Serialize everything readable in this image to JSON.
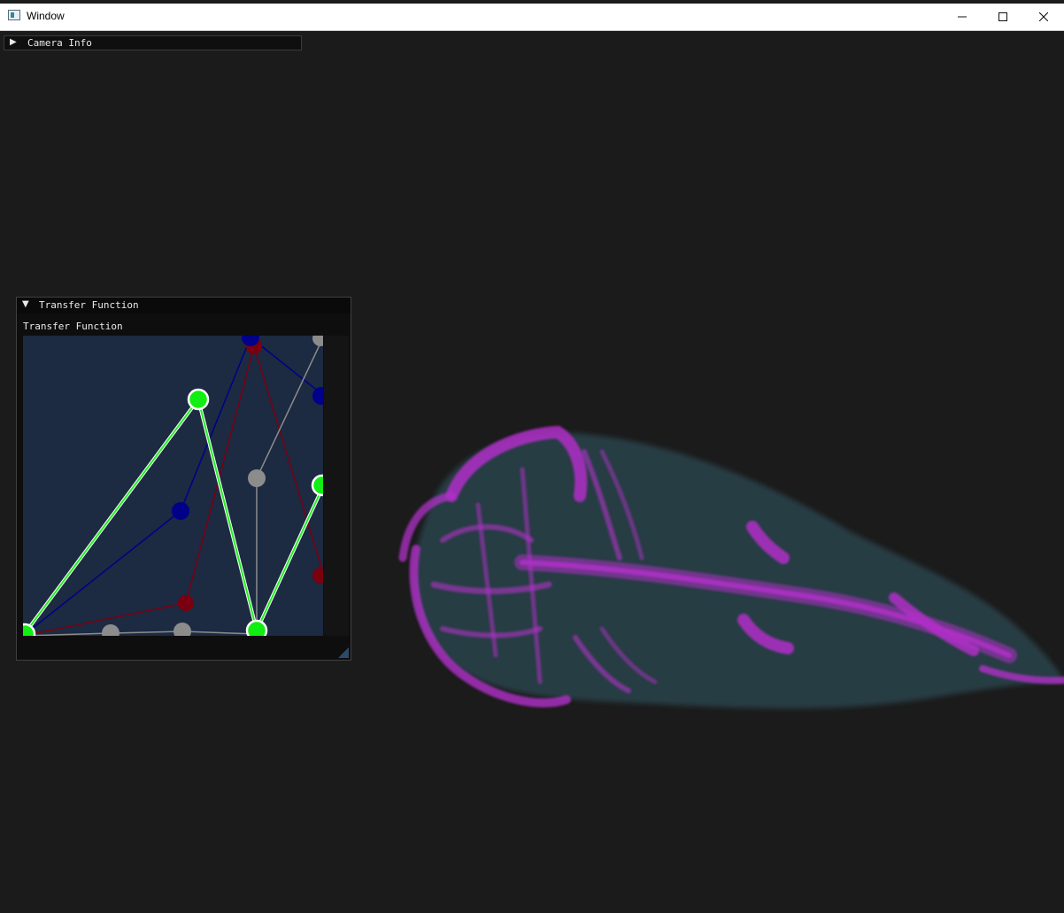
{
  "window": {
    "title": "Window"
  },
  "camera_panel": {
    "label": "Camera Info",
    "collapsed": true
  },
  "transfer_panel": {
    "header": "Transfer Function",
    "widget_label": "Transfer Function",
    "colors": {
      "red": "#7a0010",
      "green": "#22ff22",
      "blue": "#000088",
      "alpha": "#8c8c8c",
      "background": "#1c2a42"
    }
  },
  "render": {
    "bone_color": "#b030c8",
    "tissue_color": "#2e4a52"
  }
}
